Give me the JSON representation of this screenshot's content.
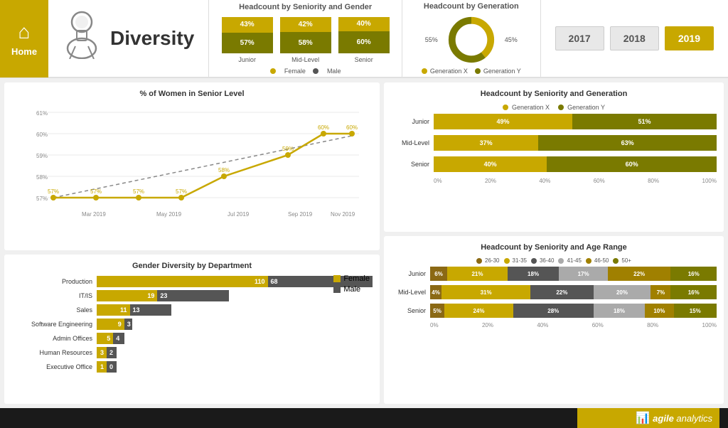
{
  "header": {
    "home_label": "Home",
    "title": "Diversity",
    "headcount_gender_title": "Headcount by Seniority and Gender",
    "bars": [
      {
        "level": "Junior",
        "female": "43%",
        "male": "57%"
      },
      {
        "level": "Mid-Level",
        "female": "42%",
        "male": "58%"
      },
      {
        "level": "Senior",
        "female": "40%",
        "male": "60%"
      }
    ],
    "legend_female": "Female",
    "legend_male": "Male",
    "headcount_gen_title": "Headcount by Generation",
    "donut_55": "55%",
    "donut_45": "45%",
    "gen_x_label": "Generation X",
    "gen_y_label": "Generation Y",
    "years": [
      "2017",
      "2018",
      "2019"
    ],
    "active_year": "2019"
  },
  "women_senior": {
    "title": "% of Women in Senior Level",
    "y_labels": [
      "61%",
      "60%",
      "59%",
      "58%",
      "57%"
    ],
    "x_labels": [
      "Mar 2019",
      "May 2019",
      "Jul 2019",
      "Sep 2019",
      "Nov 2019"
    ],
    "data_points": [
      {
        "x": 0,
        "y": "57%"
      },
      {
        "x": 1,
        "y": "57%"
      },
      {
        "x": 1.5,
        "y": "57%"
      },
      {
        "x": 2,
        "y": "57%"
      },
      {
        "x": 3,
        "y": "58%"
      },
      {
        "x": 4,
        "y": "59%"
      },
      {
        "x": 5,
        "y": "60%"
      },
      {
        "x": 6,
        "y": "60%"
      }
    ]
  },
  "gender_diversity": {
    "title": "Gender Diversity by Department",
    "legend_female": "Female",
    "legend_male": "Male",
    "departments": [
      {
        "name": "Production",
        "female": 110,
        "male": 68
      },
      {
        "name": "IT/IS",
        "female": 19,
        "male": 23
      },
      {
        "name": "Sales",
        "female": 11,
        "male": 13
      },
      {
        "name": "Software Engineering",
        "female": 9,
        "male": 3
      },
      {
        "name": "Admin Offices",
        "female": 5,
        "male": 4
      },
      {
        "name": "Human Resources",
        "female": 3,
        "male": 2
      },
      {
        "name": "Executive Office",
        "female": 1,
        "male": 0
      }
    ],
    "max_val": 178
  },
  "headcount_seniority_gen": {
    "title": "Headcount by Seniority and Generation",
    "legend_x": "Generation X",
    "legend_y": "Generation Y",
    "rows": [
      {
        "level": "Junior",
        "x_pct": 49,
        "y_pct": 51,
        "x_label": "49%",
        "y_label": "51%"
      },
      {
        "level": "Mid-Level",
        "x_pct": 37,
        "y_pct": 63,
        "x_label": "37%",
        "y_label": "63%"
      },
      {
        "level": "Senior",
        "x_pct": 40,
        "y_pct": 60,
        "x_label": "40%",
        "y_label": "60%"
      }
    ],
    "x_labels": [
      "0%",
      "20%",
      "40%",
      "60%",
      "80%",
      "100%"
    ]
  },
  "headcount_age": {
    "title": "Headcount by Seniority and Age Range",
    "legend": [
      "26-30",
      "31-35",
      "36-40",
      "41-45",
      "46-50",
      "50+"
    ],
    "colors": [
      "#8b7355",
      "#c8a800",
      "#555",
      "#a0a0a0",
      "#c8a800",
      "#7a7a00"
    ],
    "rows": [
      {
        "level": "Junior",
        "segs": [
          {
            "pct": 6,
            "label": "6%",
            "color": "#8b6914"
          },
          {
            "pct": 21,
            "label": "21%",
            "color": "#c8a800"
          },
          {
            "pct": 18,
            "label": "18%",
            "color": "#555"
          },
          {
            "pct": 17,
            "label": "17%",
            "color": "#aaa"
          },
          {
            "pct": 22,
            "label": "22%",
            "color": "#a08000"
          },
          {
            "pct": 16,
            "label": "16%",
            "color": "#7a7a00"
          }
        ]
      },
      {
        "level": "Mid-Level",
        "segs": [
          {
            "pct": 4,
            "label": "4%",
            "color": "#8b6914"
          },
          {
            "pct": 31,
            "label": "31%",
            "color": "#c8a800"
          },
          {
            "pct": 22,
            "label": "22%",
            "color": "#555"
          },
          {
            "pct": 20,
            "label": "20%",
            "color": "#aaa"
          },
          {
            "pct": 7,
            "label": "7%",
            "color": "#a08000"
          },
          {
            "pct": 16,
            "label": "16%",
            "color": "#7a7a00"
          }
        ]
      },
      {
        "level": "Senior",
        "segs": [
          {
            "pct": 5,
            "label": "5%",
            "color": "#8b6914"
          },
          {
            "pct": 24,
            "label": "24%",
            "color": "#c8a800"
          },
          {
            "pct": 28,
            "label": "28%",
            "color": "#555"
          },
          {
            "pct": 18,
            "label": "18%",
            "color": "#aaa"
          },
          {
            "pct": 10,
            "label": "10%",
            "color": "#a08000"
          },
          {
            "pct": 15,
            "label": "15%",
            "color": "#7a7a00"
          }
        ]
      }
    ],
    "x_labels": [
      "0%",
      "20%",
      "40%",
      "60%",
      "80%",
      "100%"
    ]
  },
  "footer": {
    "brand": "agile analytics"
  }
}
